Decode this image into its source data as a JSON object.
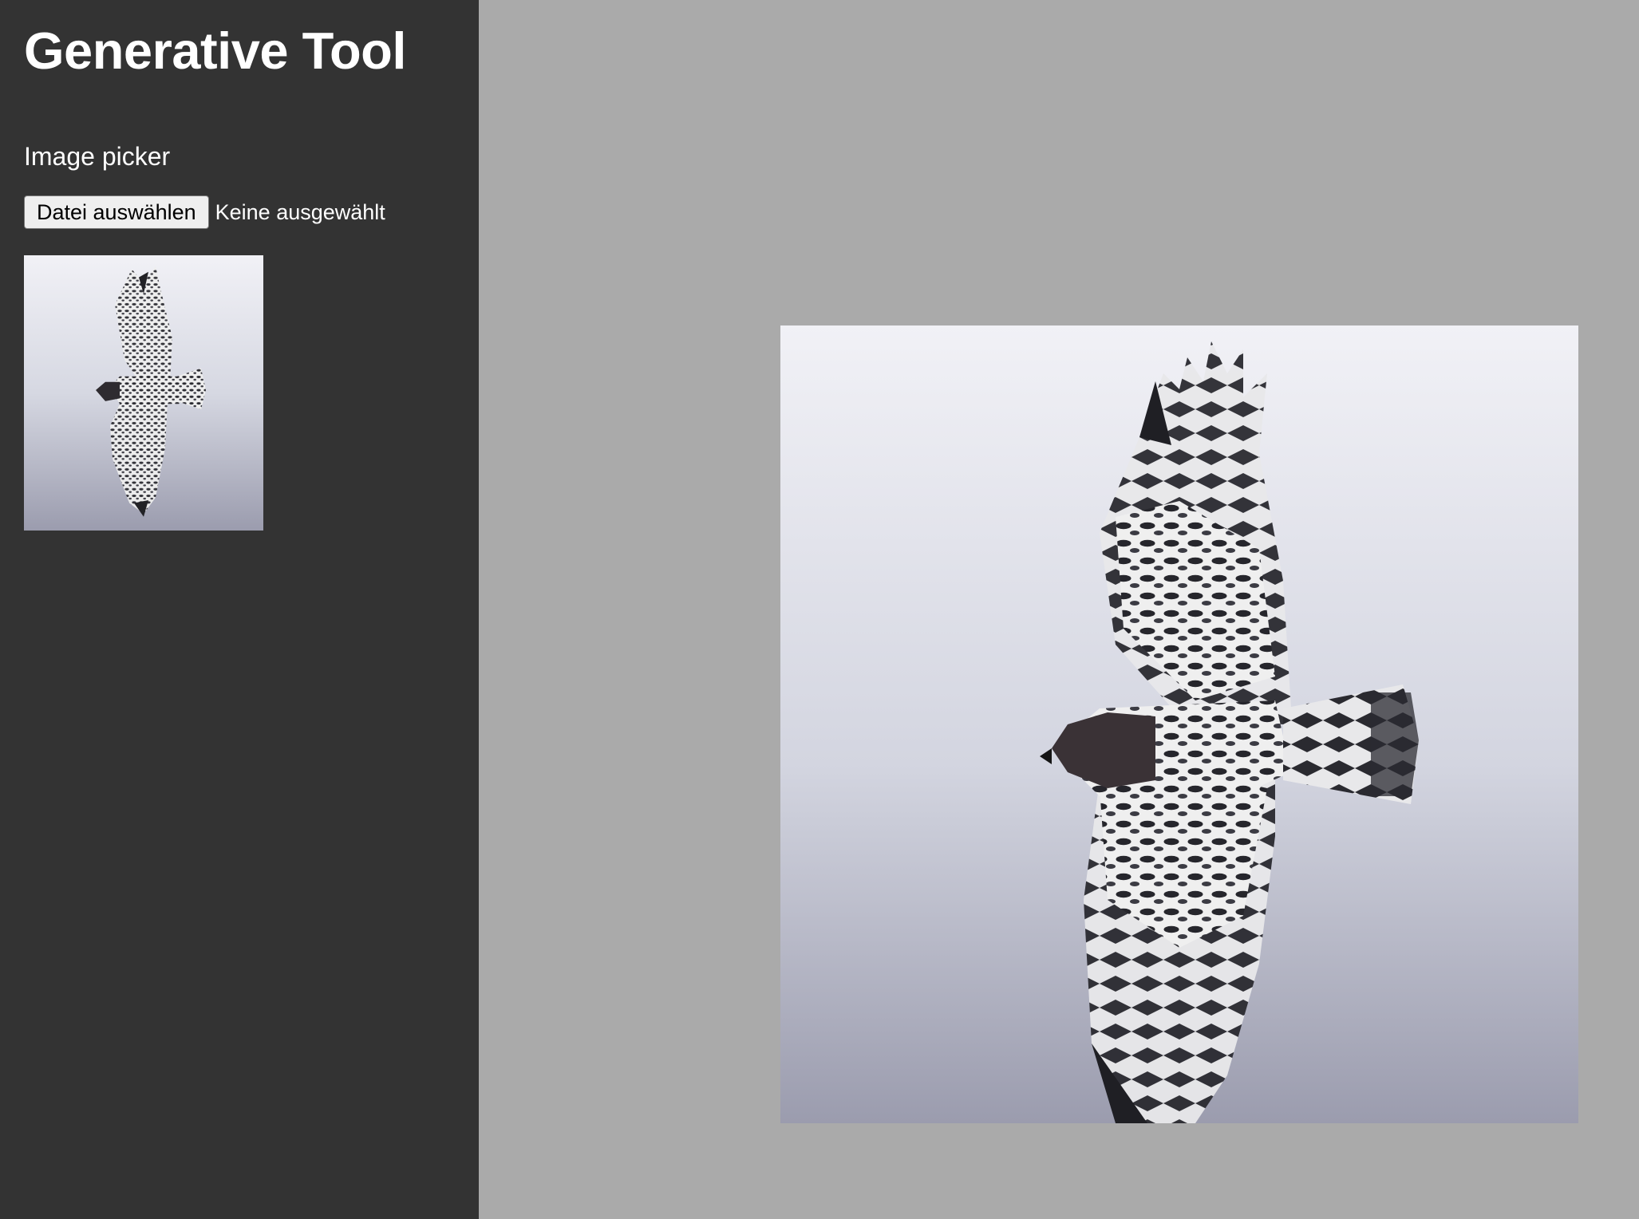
{
  "app": {
    "title": "Generative Tool"
  },
  "picker": {
    "label": "Image picker",
    "button_label": "Datei auswählen",
    "status_text": "Keine ausgewählt"
  },
  "thumbnail": {
    "icon": "hawk-photo-thumbnail"
  },
  "preview": {
    "icon": "hawk-photo-preview"
  },
  "colors": {
    "sidebar_bg": "#333333",
    "main_bg": "#aaaaaa",
    "sky_top": "#f1f1f6",
    "sky_bottom": "#9b9cae"
  }
}
